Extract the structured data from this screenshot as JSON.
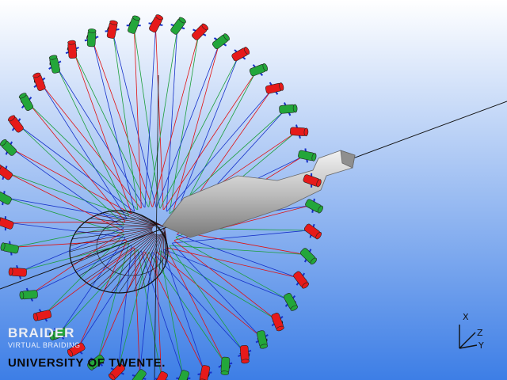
{
  "watermark": {
    "title": "BRAIDER",
    "subtitle": "VIRTUAL BRAIDING",
    "institution": "UNIVERSITY OF TWENTE."
  },
  "axes_triad": {
    "labels": [
      "X",
      "Z",
      "Y"
    ]
  },
  "scene": {
    "background_top": "#ffffff",
    "background_bottom": "#3d7ee6",
    "yarn_colors": [
      "#e01010",
      "#1b9e3a",
      "#1530c8",
      "#111111"
    ],
    "bobbin_colors": [
      "#e61a1a",
      "#23a63a"
    ],
    "mandrel_color": "#bdbdbd",
    "carrier_count": 44
  }
}
